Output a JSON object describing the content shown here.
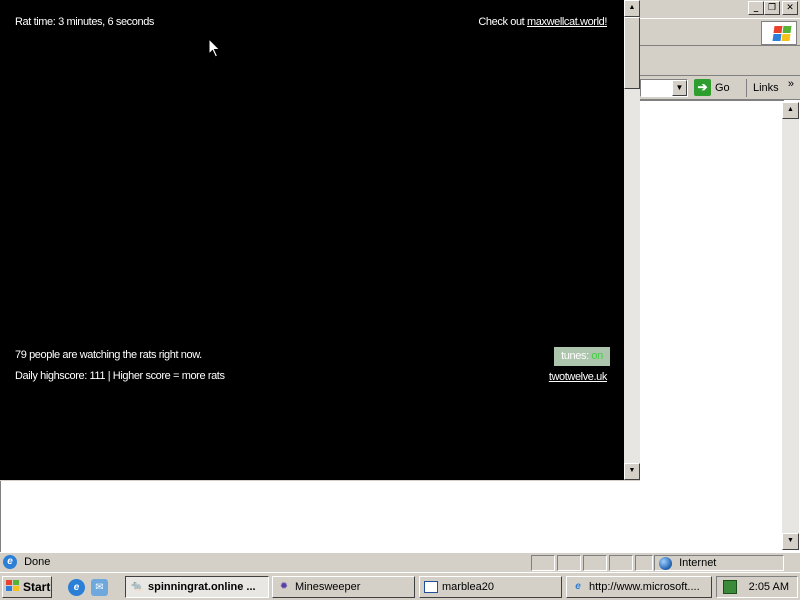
{
  "ie_window": {
    "go_label": "Go",
    "links_label": "Links",
    "status_text": "Done",
    "zone_text": "Internet"
  },
  "rat_page": {
    "rat_time": "Rat time: 3 minutes, 6 seconds",
    "checkout_prefix": "Check out ",
    "checkout_link": "maxwellcat.world!",
    "watching": "79 people are watching the rats right now.",
    "highscore": "Daily highscore: 111 | Higher score = more rats",
    "tunes_label": "tunes: ",
    "tunes_state": "on",
    "credit_link": "twotwelve.uk"
  },
  "taskbar": {
    "start_label": "Start",
    "tasks": [
      {
        "label": "spinningrat.online ...",
        "icon": "rat-page-icon",
        "active": true
      },
      {
        "label": "Minesweeper",
        "icon": "minesweeper-icon",
        "active": false
      },
      {
        "label": "marblea20",
        "icon": "window-icon",
        "active": false
      },
      {
        "label": "http://www.microsoft....",
        "icon": "ie-icon",
        "active": false
      }
    ],
    "clock": "2:05 AM"
  },
  "colors": {
    "page_bg": "#000000",
    "tunes_bg": "#adc4ad",
    "tunes_on": "#43d143",
    "chrome": "#d4d0c8"
  }
}
